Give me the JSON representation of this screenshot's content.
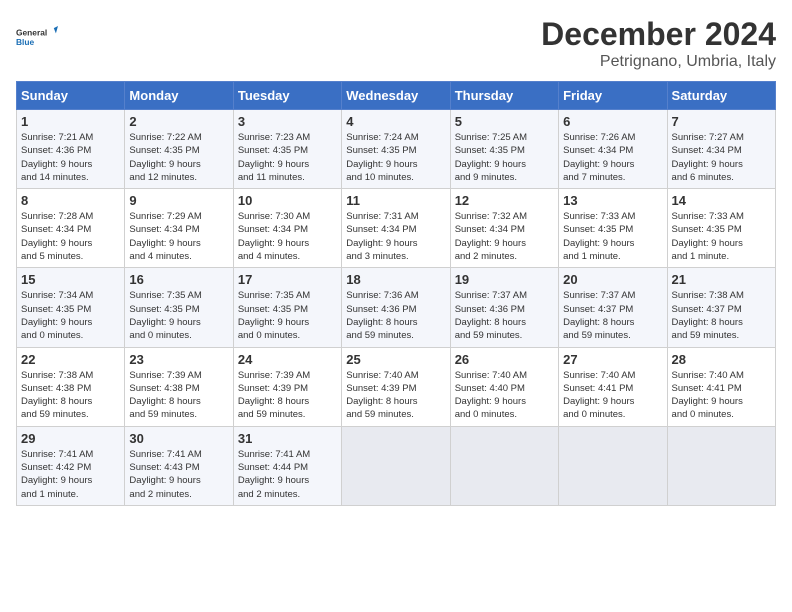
{
  "logo": {
    "line1": "General",
    "line2": "Blue"
  },
  "title": "December 2024",
  "subtitle": "Petrignano, Umbria, Italy",
  "days_of_week": [
    "Sunday",
    "Monday",
    "Tuesday",
    "Wednesday",
    "Thursday",
    "Friday",
    "Saturday"
  ],
  "weeks": [
    [
      {
        "day": "1",
        "info": "Sunrise: 7:21 AM\nSunset: 4:36 PM\nDaylight: 9 hours\nand 14 minutes."
      },
      {
        "day": "2",
        "info": "Sunrise: 7:22 AM\nSunset: 4:35 PM\nDaylight: 9 hours\nand 12 minutes."
      },
      {
        "day": "3",
        "info": "Sunrise: 7:23 AM\nSunset: 4:35 PM\nDaylight: 9 hours\nand 11 minutes."
      },
      {
        "day": "4",
        "info": "Sunrise: 7:24 AM\nSunset: 4:35 PM\nDaylight: 9 hours\nand 10 minutes."
      },
      {
        "day": "5",
        "info": "Sunrise: 7:25 AM\nSunset: 4:35 PM\nDaylight: 9 hours\nand 9 minutes."
      },
      {
        "day": "6",
        "info": "Sunrise: 7:26 AM\nSunset: 4:34 PM\nDaylight: 9 hours\nand 7 minutes."
      },
      {
        "day": "7",
        "info": "Sunrise: 7:27 AM\nSunset: 4:34 PM\nDaylight: 9 hours\nand 6 minutes."
      }
    ],
    [
      {
        "day": "8",
        "info": "Sunrise: 7:28 AM\nSunset: 4:34 PM\nDaylight: 9 hours\nand 5 minutes."
      },
      {
        "day": "9",
        "info": "Sunrise: 7:29 AM\nSunset: 4:34 PM\nDaylight: 9 hours\nand 4 minutes."
      },
      {
        "day": "10",
        "info": "Sunrise: 7:30 AM\nSunset: 4:34 PM\nDaylight: 9 hours\nand 4 minutes."
      },
      {
        "day": "11",
        "info": "Sunrise: 7:31 AM\nSunset: 4:34 PM\nDaylight: 9 hours\nand 3 minutes."
      },
      {
        "day": "12",
        "info": "Sunrise: 7:32 AM\nSunset: 4:34 PM\nDaylight: 9 hours\nand 2 minutes."
      },
      {
        "day": "13",
        "info": "Sunrise: 7:33 AM\nSunset: 4:35 PM\nDaylight: 9 hours\nand 1 minute."
      },
      {
        "day": "14",
        "info": "Sunrise: 7:33 AM\nSunset: 4:35 PM\nDaylight: 9 hours\nand 1 minute."
      }
    ],
    [
      {
        "day": "15",
        "info": "Sunrise: 7:34 AM\nSunset: 4:35 PM\nDaylight: 9 hours\nand 0 minutes."
      },
      {
        "day": "16",
        "info": "Sunrise: 7:35 AM\nSunset: 4:35 PM\nDaylight: 9 hours\nand 0 minutes."
      },
      {
        "day": "17",
        "info": "Sunrise: 7:35 AM\nSunset: 4:35 PM\nDaylight: 9 hours\nand 0 minutes."
      },
      {
        "day": "18",
        "info": "Sunrise: 7:36 AM\nSunset: 4:36 PM\nDaylight: 8 hours\nand 59 minutes."
      },
      {
        "day": "19",
        "info": "Sunrise: 7:37 AM\nSunset: 4:36 PM\nDaylight: 8 hours\nand 59 minutes."
      },
      {
        "day": "20",
        "info": "Sunrise: 7:37 AM\nSunset: 4:37 PM\nDaylight: 8 hours\nand 59 minutes."
      },
      {
        "day": "21",
        "info": "Sunrise: 7:38 AM\nSunset: 4:37 PM\nDaylight: 8 hours\nand 59 minutes."
      }
    ],
    [
      {
        "day": "22",
        "info": "Sunrise: 7:38 AM\nSunset: 4:38 PM\nDaylight: 8 hours\nand 59 minutes."
      },
      {
        "day": "23",
        "info": "Sunrise: 7:39 AM\nSunset: 4:38 PM\nDaylight: 8 hours\nand 59 minutes."
      },
      {
        "day": "24",
        "info": "Sunrise: 7:39 AM\nSunset: 4:39 PM\nDaylight: 8 hours\nand 59 minutes."
      },
      {
        "day": "25",
        "info": "Sunrise: 7:40 AM\nSunset: 4:39 PM\nDaylight: 8 hours\nand 59 minutes."
      },
      {
        "day": "26",
        "info": "Sunrise: 7:40 AM\nSunset: 4:40 PM\nDaylight: 9 hours\nand 0 minutes."
      },
      {
        "day": "27",
        "info": "Sunrise: 7:40 AM\nSunset: 4:41 PM\nDaylight: 9 hours\nand 0 minutes."
      },
      {
        "day": "28",
        "info": "Sunrise: 7:40 AM\nSunset: 4:41 PM\nDaylight: 9 hours\nand 0 minutes."
      }
    ],
    [
      {
        "day": "29",
        "info": "Sunrise: 7:41 AM\nSunset: 4:42 PM\nDaylight: 9 hours\nand 1 minute."
      },
      {
        "day": "30",
        "info": "Sunrise: 7:41 AM\nSunset: 4:43 PM\nDaylight: 9 hours\nand 2 minutes."
      },
      {
        "day": "31",
        "info": "Sunrise: 7:41 AM\nSunset: 4:44 PM\nDaylight: 9 hours\nand 2 minutes."
      },
      {
        "day": "",
        "info": ""
      },
      {
        "day": "",
        "info": ""
      },
      {
        "day": "",
        "info": ""
      },
      {
        "day": "",
        "info": ""
      }
    ]
  ]
}
